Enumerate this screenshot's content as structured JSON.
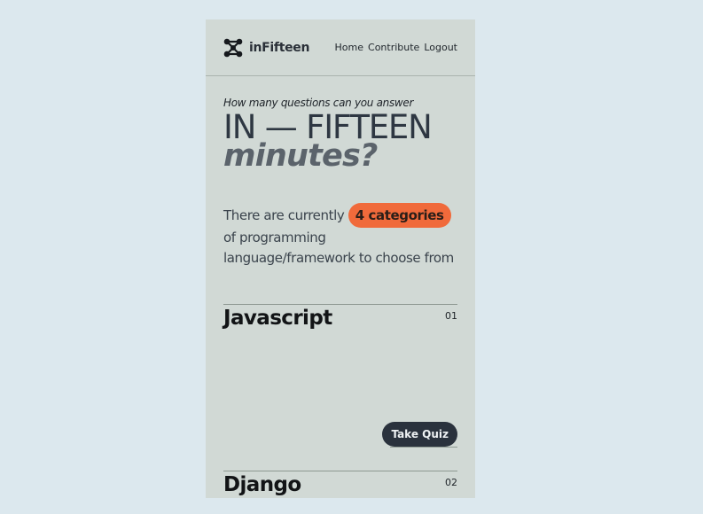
{
  "brand": {
    "name": "inFifteen",
    "icon": "molecule-logo-icon"
  },
  "nav": {
    "links": [
      "Home",
      "Contribute",
      "Logout"
    ]
  },
  "hero": {
    "intro": "How many questions can you answer",
    "title": "IN — FIFTEEN",
    "subtitle": "minutes?",
    "desc_before": "There are currently ",
    "badge": "4 categories",
    "desc_after": " of programming language/framework to choose from"
  },
  "categories": [
    {
      "name": "Javascript",
      "number": "01",
      "button": "Take Quiz"
    },
    {
      "name": "Django",
      "number": "02"
    }
  ],
  "colors": {
    "page_bg": "#dce8ee",
    "card_bg": "#d1d9d5",
    "accent": "#f06a3b",
    "button_bg": "#2a323d"
  }
}
